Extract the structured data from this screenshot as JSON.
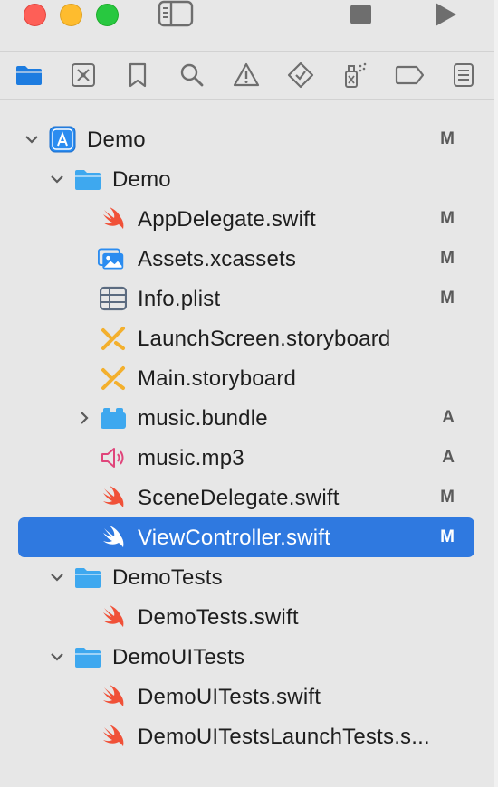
{
  "colors": {
    "accent": "#2f79e0",
    "swift": "#f05138",
    "folder": "#3ea8ef",
    "storyboard": "#f3b02e",
    "audio": "#e0457b"
  },
  "toolbar": {
    "sidebar_toggle_icon": "sidebar-icon",
    "stop_icon": "stop-icon",
    "run_icon": "play-icon"
  },
  "navigator": {
    "tabs": [
      {
        "icon": "folder-icon",
        "active": true
      },
      {
        "icon": "source-control-icon"
      },
      {
        "icon": "bookmark-icon"
      },
      {
        "icon": "search-icon"
      },
      {
        "icon": "warning-icon"
      },
      {
        "icon": "test-diamond-icon"
      },
      {
        "icon": "debug-spray-icon"
      },
      {
        "icon": "breakpoint-tag-icon"
      },
      {
        "icon": "report-list-icon"
      }
    ]
  },
  "tree": {
    "items": [
      {
        "label": "Demo",
        "badge": "M",
        "icon": "app-project-icon",
        "depth": 0,
        "chevron": "down"
      },
      {
        "label": "Demo",
        "badge": "",
        "icon": "folder-icon",
        "depth": 1,
        "chevron": "down"
      },
      {
        "label": "AppDelegate.swift",
        "badge": "M",
        "icon": "swift-icon",
        "depth": 2
      },
      {
        "label": "Assets.xcassets",
        "badge": "M",
        "icon": "assets-icon",
        "depth": 2
      },
      {
        "label": "Info.plist",
        "badge": "M",
        "icon": "plist-icon",
        "depth": 2
      },
      {
        "label": "LaunchScreen.storyboard",
        "badge": "",
        "icon": "storyboard-icon",
        "depth": 2
      },
      {
        "label": "Main.storyboard",
        "badge": "",
        "icon": "storyboard-icon",
        "depth": 2
      },
      {
        "label": "music.bundle",
        "badge": "A",
        "icon": "bundle-icon",
        "depth": 2,
        "chevron": "right"
      },
      {
        "label": "music.mp3",
        "badge": "A",
        "icon": "audio-icon",
        "depth": 2
      },
      {
        "label": "SceneDelegate.swift",
        "badge": "M",
        "icon": "swift-icon",
        "depth": 2
      },
      {
        "label": "ViewController.swift",
        "badge": "M",
        "icon": "swift-icon",
        "depth": 2,
        "selected": true
      },
      {
        "label": "DemoTests",
        "badge": "",
        "icon": "folder-icon",
        "depth": 1,
        "chevron": "down"
      },
      {
        "label": "DemoTests.swift",
        "badge": "",
        "icon": "swift-icon",
        "depth": 2
      },
      {
        "label": "DemoUITests",
        "badge": "",
        "icon": "folder-icon",
        "depth": 1,
        "chevron": "down"
      },
      {
        "label": "DemoUITests.swift",
        "badge": "",
        "icon": "swift-icon",
        "depth": 2
      },
      {
        "label": "DemoUITestsLaunchTests.s...",
        "badge": "",
        "icon": "swift-icon",
        "depth": 2
      }
    ]
  }
}
